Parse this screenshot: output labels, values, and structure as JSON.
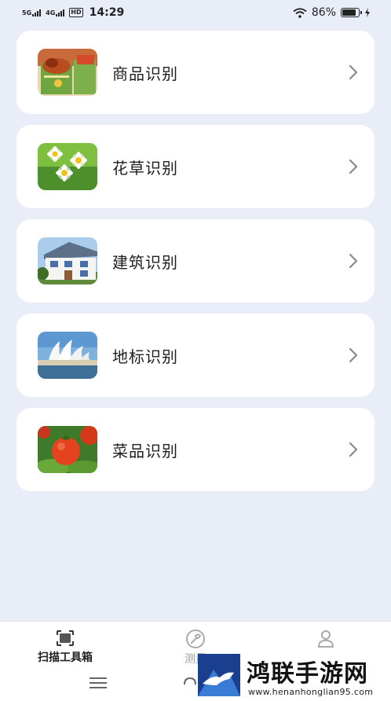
{
  "status_bar": {
    "signal1": "5G",
    "signal2": "4G",
    "hd": "HD",
    "time": "14:29",
    "battery_percent": "86%",
    "battery_level": 0.86
  },
  "items": [
    {
      "label": "商品识别",
      "icon": "goods-thumbnail"
    },
    {
      "label": "花草识别",
      "icon": "flower-thumbnail"
    },
    {
      "label": "建筑识别",
      "icon": "building-thumbnail"
    },
    {
      "label": "地标识别",
      "icon": "landmark-thumbnail"
    },
    {
      "label": "菜品识别",
      "icon": "dish-thumbnail"
    }
  ],
  "bottom_nav": {
    "tabs": [
      {
        "label": "扫描工具箱",
        "icon": "scan-icon",
        "active": true
      },
      {
        "label": "测量",
        "icon": "wrench-icon",
        "active": false
      },
      {
        "label": "",
        "icon": "user-icon",
        "active": false
      }
    ]
  },
  "watermark": {
    "title": "鸿联手游网",
    "url": "www.henanhonglian95.com"
  }
}
